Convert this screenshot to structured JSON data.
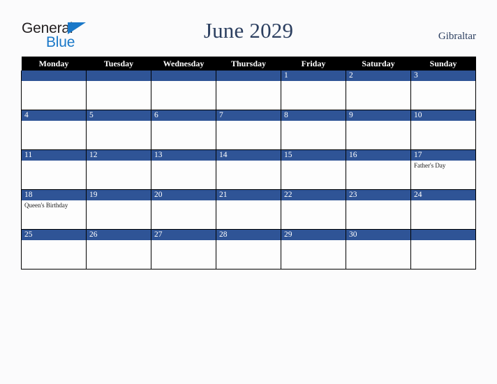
{
  "brand": {
    "name_part1": "General",
    "name_part2": "Blue",
    "triangle_color": "#1a78c8"
  },
  "header": {
    "title": "June 2029",
    "country": "Gibraltar"
  },
  "theme": {
    "accent_blue": "#2f5496",
    "header_black": "#000000",
    "title_navy": "#2c3f60",
    "page_background": "#fbfbfc",
    "cell_background": "#fdfdfd"
  },
  "calendar": {
    "weekday_headers": [
      "Monday",
      "Tuesday",
      "Wednesday",
      "Thursday",
      "Friday",
      "Saturday",
      "Sunday"
    ],
    "weeks": [
      [
        {
          "date": "",
          "events": []
        },
        {
          "date": "",
          "events": []
        },
        {
          "date": "",
          "events": []
        },
        {
          "date": "",
          "events": []
        },
        {
          "date": "1",
          "events": []
        },
        {
          "date": "2",
          "events": []
        },
        {
          "date": "3",
          "events": []
        }
      ],
      [
        {
          "date": "4",
          "events": []
        },
        {
          "date": "5",
          "events": []
        },
        {
          "date": "6",
          "events": []
        },
        {
          "date": "7",
          "events": []
        },
        {
          "date": "8",
          "events": []
        },
        {
          "date": "9",
          "events": []
        },
        {
          "date": "10",
          "events": []
        }
      ],
      [
        {
          "date": "11",
          "events": []
        },
        {
          "date": "12",
          "events": []
        },
        {
          "date": "13",
          "events": []
        },
        {
          "date": "14",
          "events": []
        },
        {
          "date": "15",
          "events": []
        },
        {
          "date": "16",
          "events": []
        },
        {
          "date": "17",
          "events": [
            "Father's Day"
          ]
        }
      ],
      [
        {
          "date": "18",
          "events": [
            "Queen's Birthday"
          ]
        },
        {
          "date": "19",
          "events": []
        },
        {
          "date": "20",
          "events": []
        },
        {
          "date": "21",
          "events": []
        },
        {
          "date": "22",
          "events": []
        },
        {
          "date": "23",
          "events": []
        },
        {
          "date": "24",
          "events": []
        }
      ],
      [
        {
          "date": "25",
          "events": []
        },
        {
          "date": "26",
          "events": []
        },
        {
          "date": "27",
          "events": []
        },
        {
          "date": "28",
          "events": []
        },
        {
          "date": "29",
          "events": []
        },
        {
          "date": "30",
          "events": []
        },
        {
          "date": "",
          "events": []
        }
      ]
    ]
  }
}
